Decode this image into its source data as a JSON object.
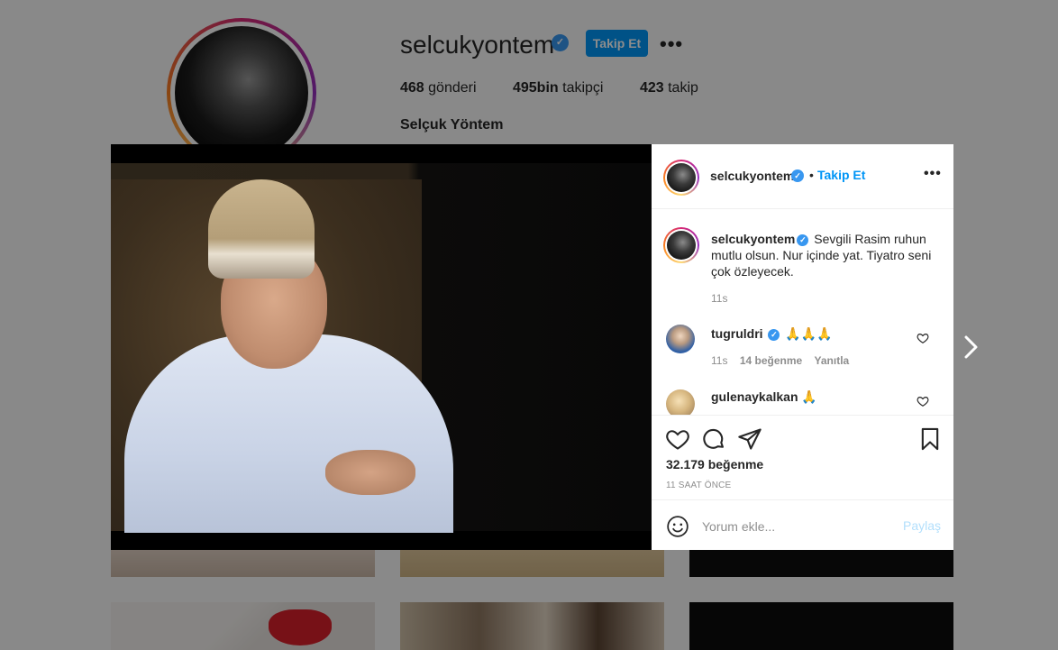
{
  "profile": {
    "username": "selcukyontem",
    "follow_label": "Takip Et",
    "more_icon": "more-horizontal-icon",
    "stats": [
      {
        "count": "468",
        "label": "gönderi"
      },
      {
        "count": "495bin",
        "label": "takipçi"
      },
      {
        "count": "423",
        "label": "takip"
      }
    ],
    "full_name": "Selçuk Yöntem"
  },
  "post": {
    "header": {
      "username": "selcukyontem",
      "separator": "•",
      "follow_label": "Takip Et"
    },
    "caption": {
      "username": "selcukyontem",
      "text": "Sevgili Rasim ruhun mutlu olsun. Nur içinde yat. Tiyatro seni çok özleyecek.",
      "time": "11s"
    },
    "comments": [
      {
        "username": "tugruldri",
        "text": "🙏🙏🙏",
        "time": "11s",
        "likes": "14 beğenme",
        "reply_label": "Yanıtla"
      },
      {
        "username": "gulenaykalkan",
        "text": "🙏"
      }
    ],
    "likes_count": "32.179 beğenme",
    "time_ago": "11 SAAT ÖNCE",
    "comment_placeholder": "Yorum ekle...",
    "post_button": "Paylaş"
  },
  "colors": {
    "accent": "#0095f6",
    "verified": "#3897f0",
    "muted": "#8e8e8e",
    "post_disabled": "#b2dffc"
  }
}
